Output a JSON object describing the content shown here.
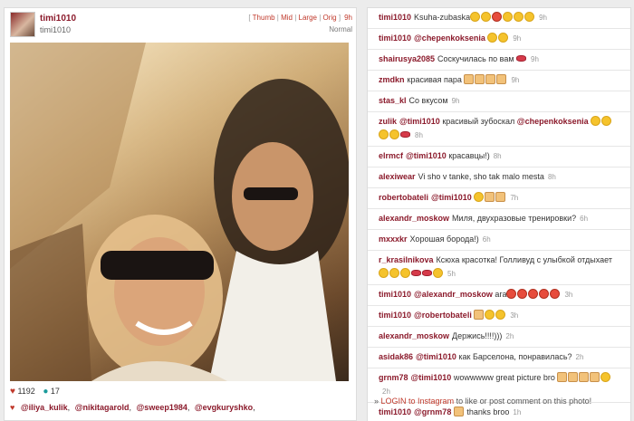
{
  "post": {
    "username": "timi1010",
    "display_name": "timi1010",
    "sizes": [
      "Thumb",
      "Mid",
      "Large",
      "Orig"
    ],
    "time_ago": "9h",
    "filter": "Normal",
    "likes": "1192",
    "comments_count": "17",
    "tags": [
      "@iliya_kulik",
      "@nikitagarold",
      "@sweep1984",
      "@evgkuryshko"
    ]
  },
  "comments": [
    {
      "user": "timi1010",
      "text": "Ksuha-zubaska",
      "time": "9h"
    },
    {
      "user": "timi1010",
      "mention": "@chepenkoksenia",
      "text": "",
      "time": "9h"
    },
    {
      "user": "shairusya2085",
      "text": "Соскучилась по вам",
      "time": "9h"
    },
    {
      "user": "zmdkn",
      "text": "красивая пара",
      "time": "9h"
    },
    {
      "user": "stas_kl",
      "text": "Со вкусом",
      "time": "9h"
    },
    {
      "user": "zulik",
      "mention": "@timi1010",
      "text": "красивый зубоскал",
      "mention2": "@chepenkoksenia",
      "time": "8h"
    },
    {
      "user": "elrmcf",
      "mention": "@timi1010",
      "text": "красавцы!)",
      "time": "8h"
    },
    {
      "user": "alexiwear",
      "text": "Vi sho v tanke, sho tak malo mesta",
      "time": "8h"
    },
    {
      "user": "robertobateli",
      "mention": "@timi1010",
      "text": "",
      "time": "7h"
    },
    {
      "user": "alexandr_moskow",
      "text": "Миля, двухразовые тренировки?",
      "time": "6h"
    },
    {
      "user": "mxxxkr",
      "text": "Хорошая борода!)",
      "time": "6h"
    },
    {
      "user": "r_krasilnikova",
      "text": "Ксюха красотка! Голливуд с улыбкой отдыхает",
      "time": "5h"
    },
    {
      "user": "timi1010",
      "mention": "@alexandr_moskow",
      "text": "ага",
      "time": "3h"
    },
    {
      "user": "timi1010",
      "mention": "@robertobateli",
      "text": "",
      "time": "3h"
    },
    {
      "user": "alexandr_moskow",
      "text": "Держись!!!!)))",
      "time": "2h"
    },
    {
      "user": "asidak86",
      "mention": "@timi1010",
      "text": "как Барселона, понравилась?",
      "time": "2h"
    },
    {
      "user": "grnm78",
      "mention": "@timi1010",
      "text": "wowwwww great picture bro",
      "time": "2h"
    },
    {
      "user": "timi1010",
      "mention": "@grnm78",
      "text": "thanks broo",
      "time": "1h"
    }
  ],
  "login": {
    "prefix": "»",
    "link": "LOGIN to Instagram",
    "suffix": "to like or post comment on this photo!"
  }
}
